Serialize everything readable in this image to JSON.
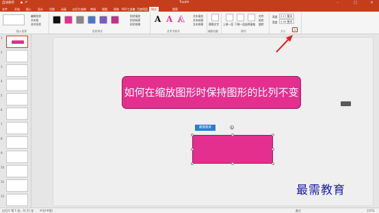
{
  "titlebar": {
    "autosave": "自动保存",
    "doc_title": "Tuyple",
    "context_label": "绘图工具",
    "search": "搜索"
  },
  "tabs": [
    "文件",
    "开始",
    "插入",
    "设计",
    "切换",
    "动画",
    "幻灯片放映",
    "审阅",
    "视图",
    "帮助",
    "PDF工具集",
    "百度网盘",
    "格式"
  ],
  "active_tab": "格式",
  "ribbon": {
    "groups": {
      "insert_shapes": "插入形状",
      "shape_styles": "形状样式",
      "wordart_styles": "艺术字样式",
      "accessibility": "辅助功能",
      "arrange": "排列",
      "size": "大小"
    },
    "edit_shape": "编辑形状",
    "text_box": "文本框",
    "merge_shapes": "合并形状",
    "shape_fill": "形状填充",
    "shape_outline": "形状轮廓",
    "shape_effects": "形状效果",
    "text_fill": "文本填充",
    "text_outline": "文本轮廓",
    "text_effects": "文本效果",
    "alt_text": "替换文字",
    "bring_forward": "上移一层",
    "send_backward": "下移一层",
    "selection_pane": "选择窗格",
    "align": "对齐",
    "group": "组合",
    "rotate": "旋转",
    "height_label": "高度",
    "height_value": "2.17 厘米",
    "width_label": "宽度",
    "width_value": "5.99 厘米",
    "wordart_letters": [
      "A",
      "A",
      "A"
    ]
  },
  "thumbs": [
    "1",
    "2",
    "3",
    "4",
    "5",
    "6",
    "7",
    "8",
    "9",
    "10",
    "11",
    "12"
  ],
  "slide": {
    "title_text": "如何在缩放图形时保持图形的比列不变",
    "selection_badge": "最需教育"
  },
  "watermark": "最需教育",
  "status": {
    "slide_info": "幻灯片 第 1 张，共 21 张",
    "lang": "中文(中国)",
    "notes": "备注",
    "zoom": "115%"
  },
  "colors": {
    "accent": "#c43e1c",
    "shape_fill": "#e42f8f",
    "arrow": "#e0201b"
  }
}
